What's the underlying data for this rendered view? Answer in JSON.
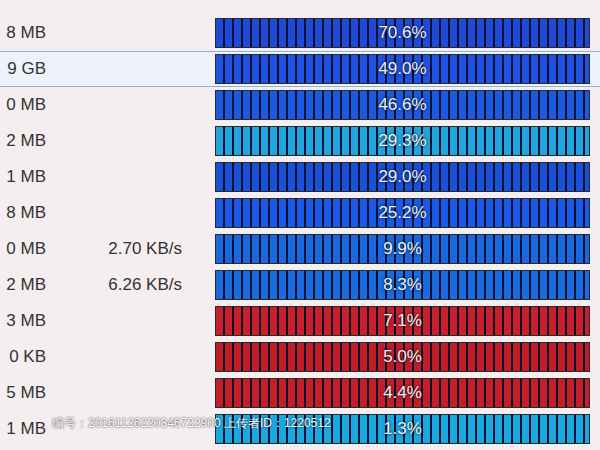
{
  "process_list": {
    "rows": [
      {
        "size": "8 MB",
        "percent": "70.6%",
        "color": "#1f4ad8",
        "selected": false
      },
      {
        "size": "9 GB",
        "percent": "49.0%",
        "color": "#1e52e2",
        "selected": true
      },
      {
        "size": "0 MB",
        "percent": "46.6%",
        "color": "#1a5ae0",
        "selected": false
      },
      {
        "size": "2 MB",
        "percent": "29.3%",
        "color": "#22a4dc",
        "selected": false
      },
      {
        "size": "1 MB",
        "percent": "29.0%",
        "color": "#1850d8",
        "selected": false
      },
      {
        "size": "8 MB",
        "percent": "25.2%",
        "color": "#1a5ae8",
        "selected": false
      },
      {
        "size": "0 MB",
        "rate": "2.70 KB/s",
        "percent": "9.9%",
        "color": "#1a68e0",
        "selected": false
      },
      {
        "size": "2 MB",
        "rate": "6.26 KB/s",
        "percent": "8.3%",
        "color": "#1a6ae0",
        "selected": false
      },
      {
        "size": "3 MB",
        "percent": "7.1%",
        "color": "#c8202a",
        "selected": false
      },
      {
        "size": "0 KB",
        "percent": "5.0%",
        "color": "#c01c24",
        "selected": false
      },
      {
        "size": "5 MB",
        "percent": "4.4%",
        "color": "#c41e26",
        "selected": false
      },
      {
        "size": "1 MB",
        "percent": "1.3%",
        "color": "#1aa8e0",
        "selected": false
      }
    ]
  },
  "watermark": {
    "text": "编号：20161126220346722900 上传者ID：1220512"
  }
}
